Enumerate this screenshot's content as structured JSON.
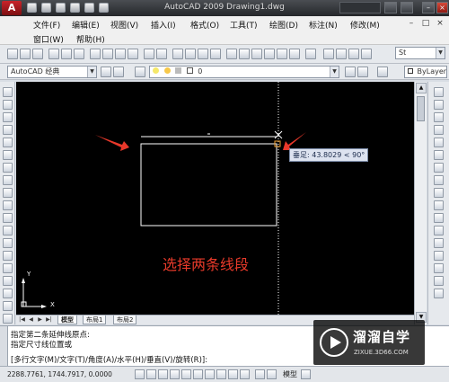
{
  "title_bar": {
    "logo": "A",
    "title": "AutoCAD 2009 Drawing1.dwg",
    "minimize": "–",
    "restore": "□",
    "close": "×"
  },
  "menu": {
    "row1": [
      "文件(F)",
      "编辑(E)",
      "视图(V)",
      "插入(I)",
      "格式(O)",
      "工具(T)",
      "绘图(D)",
      "标注(N)",
      "修改(M)"
    ],
    "row2": [
      "窗口(W)",
      "帮助(H)"
    ]
  },
  "toolbar": {
    "workspace": "AutoCAD 经典",
    "layer": "0",
    "text_style": "St",
    "color": "ByLayer"
  },
  "canvas": {
    "tooltip": "垂足: 43.8029 < 90°",
    "annotation": "选择两条线段",
    "annotation_color": "#e83a2a",
    "ucs_x": "X",
    "ucs_y": "Y"
  },
  "tabs": [
    "模型",
    "布局1",
    "布局2"
  ],
  "command_line": {
    "line1": "指定第二条延伸线原点:",
    "line2": "指定尺寸线位置或",
    "line3": "[多行文字(M)/文字(T)/角度(A)/水平(H)/垂直(V)/旋转(R)]:"
  },
  "status_bar": {
    "coordinates": "2288.7761, 1744.7917, 0.0000",
    "model_label": "模型"
  },
  "watermark": {
    "title": "溜溜自学",
    "url": "ZIXUE.3D66.COM"
  }
}
